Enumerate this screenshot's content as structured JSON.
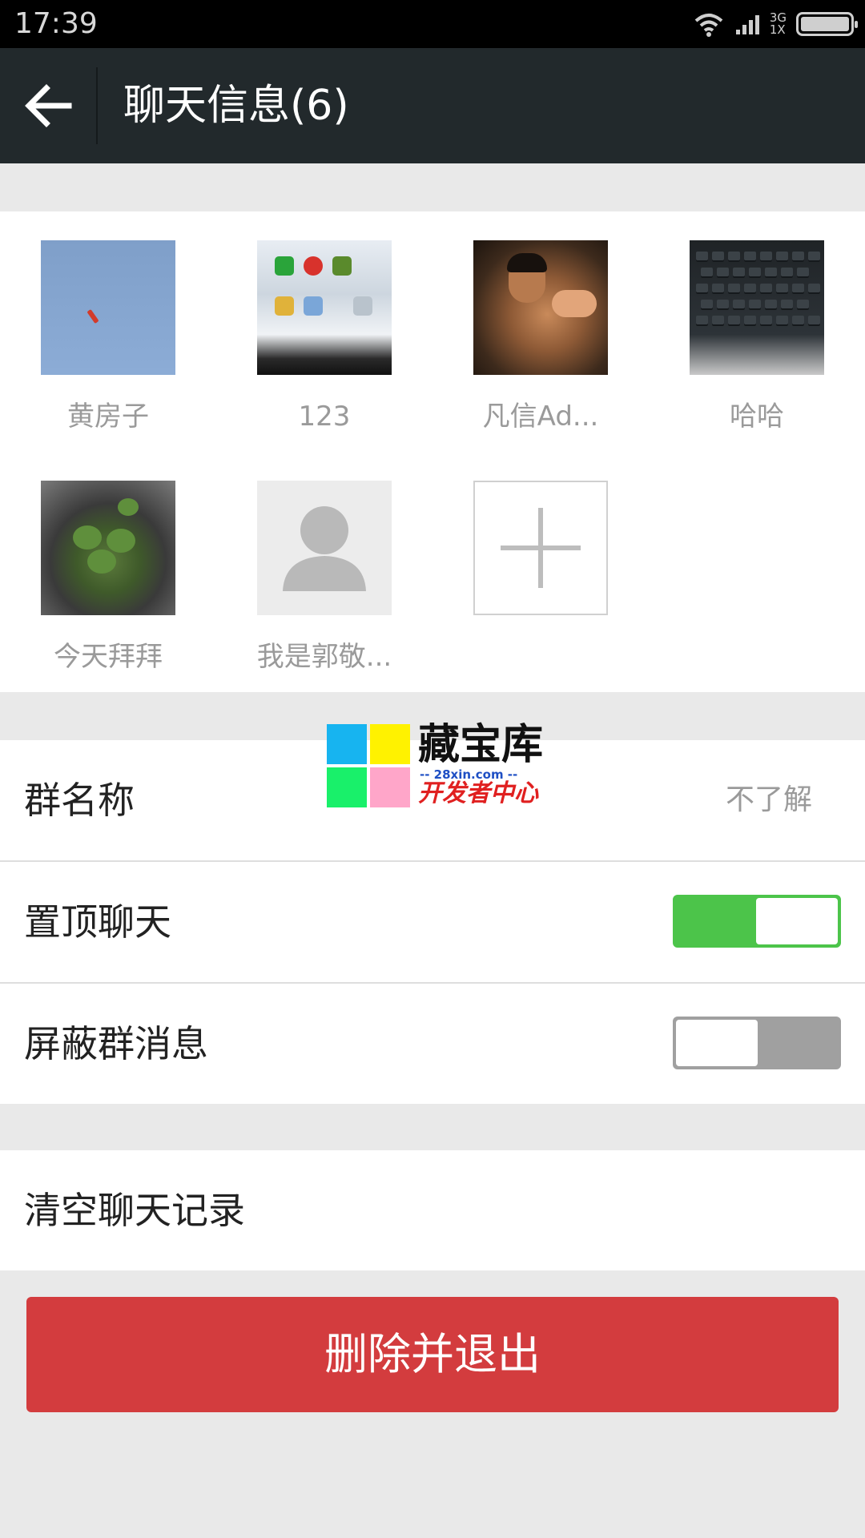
{
  "status_bar": {
    "time": "17:39",
    "network_top": "3G",
    "network_bottom": "1X",
    "icons": [
      "wifi-icon",
      "signal-icon",
      "battery-icon"
    ]
  },
  "header": {
    "back_icon": "arrow-left-icon",
    "title": "聊天信息(6)"
  },
  "members": [
    {
      "name": "黄房子"
    },
    {
      "name": "123"
    },
    {
      "name": "凡信Ad..."
    },
    {
      "name": "哈哈"
    },
    {
      "name": "今天拜拜"
    },
    {
      "name": "我是郭敬..."
    }
  ],
  "add_member_icon": "plus-icon",
  "settings": {
    "group_name_label": "群名称",
    "group_name_value": "不了解",
    "pin_chat_label": "置顶聊天",
    "pin_chat_on": true,
    "mute_label": "屏蔽群消息",
    "mute_on": false,
    "clear_history_label": "清空聊天记录"
  },
  "delete_button_label": "删除并退出",
  "watermark": {
    "title": "藏宝库",
    "url": "-- 28xin.com --",
    "subtitle": "开发者中心"
  },
  "colors": {
    "app_bar": "#22292c",
    "toggle_on": "#4cc44a",
    "toggle_off": "#a0a0a0",
    "delete_button": "#d33c3e",
    "background": "#e9e9e9"
  }
}
